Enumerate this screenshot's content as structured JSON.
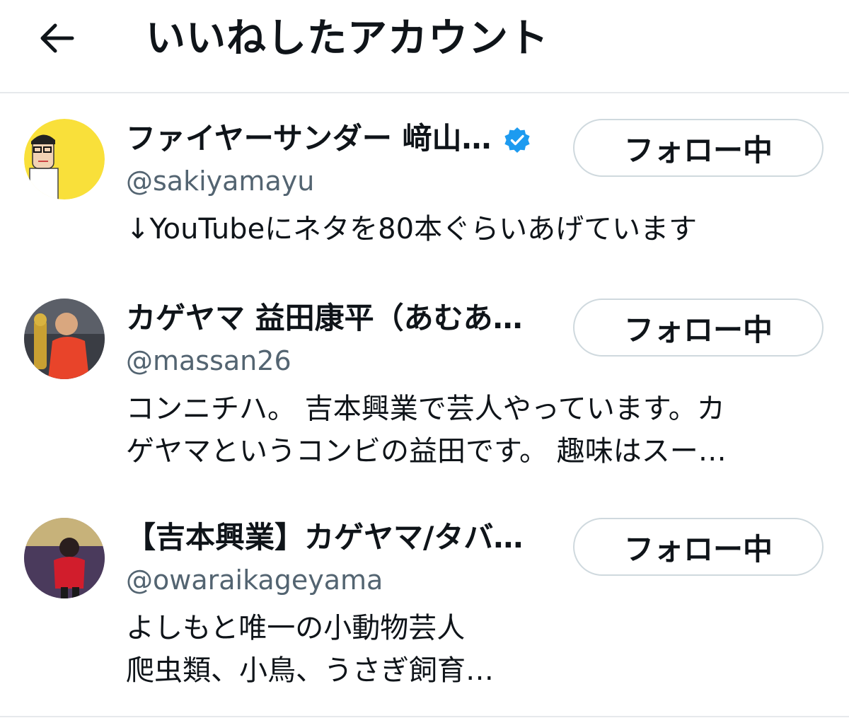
{
  "header": {
    "title": "いいねしたアカウント"
  },
  "accounts": [
    {
      "name": "ファイヤーサンダー 﨑山…",
      "verified": true,
      "handle": "@sakiyamayu",
      "bio_lines": [
        "↓YouTubeにネタを80本ぐらいあげています"
      ],
      "follow_label": "フォロー中"
    },
    {
      "name": "カゲヤマ 益田康平（あむあ…",
      "verified": false,
      "handle": "@massan26",
      "bio_lines": [
        "コンニチハ。 吉本興業で芸人やっています。カ",
        "ゲヤマというコンビの益田です。 趣味はスー…"
      ],
      "follow_label": "フォロー中"
    },
    {
      "name": "【吉本興業】カゲヤマ/タバ…",
      "verified": false,
      "handle": "@owaraikageyama",
      "bio_lines": [
        "よしもと唯一の小動物芸人",
        "爬虫類、小鳥、うさぎ飼育…"
      ],
      "follow_label": "フォロー中"
    }
  ],
  "colors": {
    "verified": "#1d9bf0",
    "handle": "#536471",
    "divider": "#e6e9ec"
  }
}
